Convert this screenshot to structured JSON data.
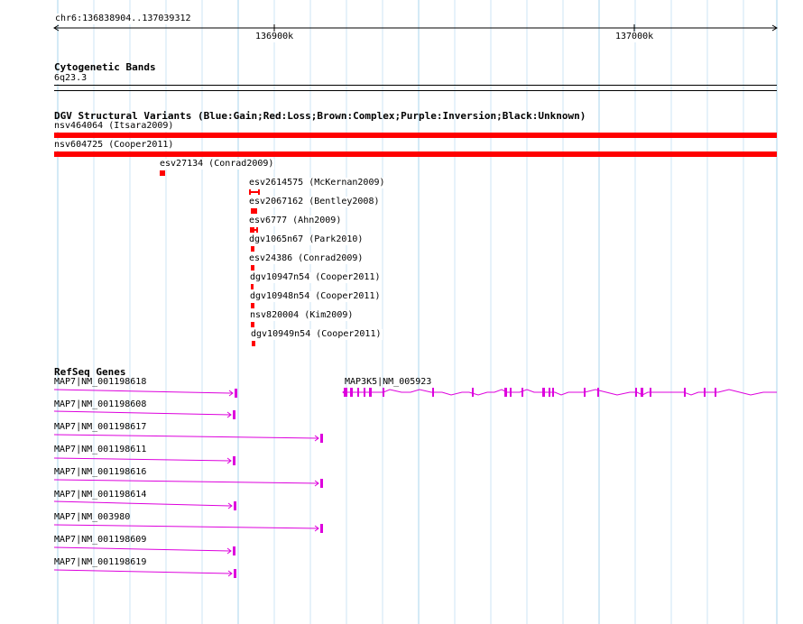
{
  "location": "chr6:136838904..137039312",
  "ruler": {
    "ticks": [
      "136900k",
      "137000k"
    ]
  },
  "cytobands": {
    "title": "Cytogenetic Bands",
    "band": "6q23.3"
  },
  "dgv": {
    "title": "DGV Structural Variants (Blue:Gain;Red:Loss;Brown:Complex;Purple:Inversion;Black:Unknown)",
    "color": "#ff0000",
    "variants": [
      {
        "label": "nsv464064 (Itsara2009)"
      },
      {
        "label": "nsv604725 (Cooper2011)"
      },
      {
        "label": "esv27134 (Conrad2009)"
      },
      {
        "label": "esv2614575 (McKernan2009)"
      },
      {
        "label": "esv2067162 (Bentley2008)"
      },
      {
        "label": "esv6777 (Ahn2009)"
      },
      {
        "label": "dgv1065n67 (Park2010)"
      },
      {
        "label": "esv24386 (Conrad2009)"
      },
      {
        "label": "dgv10947n54 (Cooper2011)"
      },
      {
        "label": "dgv10948n54 (Cooper2011)"
      },
      {
        "label": "nsv820004 (Kim2009)"
      },
      {
        "label": "dgv10949n54 (Cooper2011)"
      }
    ]
  },
  "refseq": {
    "title": "RefSeq Genes",
    "color": "#dd00dd",
    "genes": [
      {
        "label": "MAP7|NM_001198618"
      },
      {
        "label": "MAP7|NM_001198608"
      },
      {
        "label": "MAP7|NM_001198617"
      },
      {
        "label": "MAP7|NM_001198611"
      },
      {
        "label": "MAP7|NM_001198616"
      },
      {
        "label": "MAP7|NM_001198614"
      },
      {
        "label": "MAP7|NM_003980"
      },
      {
        "label": "MAP7|NM_001198609"
      },
      {
        "label": "MAP7|NM_001198619"
      },
      {
        "label": "MAP3K5|NM_005923"
      }
    ]
  }
}
